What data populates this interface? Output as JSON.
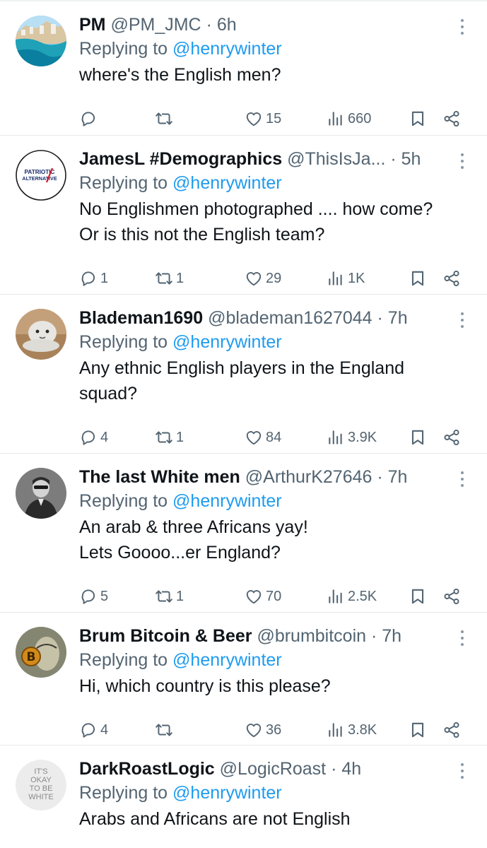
{
  "tweets": [
    {
      "name": "PM",
      "handle": "@PM_JMC",
      "time": "6h",
      "replying_prefix": "Replying to",
      "replying_to": "@henrywinter",
      "text_lines": [
        "where's the English men?"
      ],
      "replies": "",
      "retweets": "",
      "likes": "15",
      "views": "660",
      "avatar": "coastline-photo"
    },
    {
      "name": "JamesL #Demographics",
      "handle": "@ThisIsJa...",
      "time": "5h",
      "replying_prefix": "Replying to",
      "replying_to": "@henrywinter",
      "text_lines": [
        "No Englishmen photographed .... how come?",
        "Or is this not the English team?"
      ],
      "replies": "1",
      "retweets": "1",
      "likes": "29",
      "views": "1K",
      "avatar": "patriotic-alternative-logo",
      "avatar_text": [
        "PATRIOTIC",
        "ALTERNATIVE"
      ]
    },
    {
      "name": "Blademan1690",
      "handle": "@blademan1627044",
      "time": "7h",
      "replying_prefix": "Replying to",
      "replying_to": "@henrywinter",
      "text_lines": [
        "Any ethnic English players in the England",
        "squad?"
      ],
      "replies": "4",
      "retweets": "1",
      "likes": "84",
      "views": "3.9K",
      "avatar": "plush-toy-photo"
    },
    {
      "name": "The last White men",
      "handle": "@ArthurK27646",
      "time": "7h",
      "replying_prefix": "Replying to",
      "replying_to": "@henrywinter",
      "text_lines": [
        "An arab & three Africans yay!",
        "Lets Goooo...er England?"
      ],
      "replies": "5",
      "retweets": "1",
      "likes": "70",
      "views": "2.5K",
      "avatar": "man-portrait-bw"
    },
    {
      "name": "Brum Bitcoin & Beer",
      "handle": "@brumbitcoin",
      "time": "7h",
      "replying_prefix": "Replying to",
      "replying_to": "@henrywinter",
      "text_lines": [
        "Hi, which country is this please?"
      ],
      "replies": "4",
      "retweets": "",
      "likes": "36",
      "views": "3.8K",
      "avatar": "bitcoin-banknote"
    },
    {
      "name": "DarkRoastLogic",
      "handle": "@LogicRoast",
      "time": "4h",
      "replying_prefix": "Replying to",
      "replying_to": "@henrywinter",
      "text_lines": [
        "Arabs and Africans are not English"
      ],
      "replies": "",
      "retweets": "",
      "likes": "",
      "views": "",
      "avatar": "text-logo",
      "avatar_text": [
        "IT'S",
        "OKAY",
        "TO BE",
        "WHITE"
      ]
    }
  ],
  "dot_separator": "·",
  "colors": {
    "text": "#0f1419",
    "secondary": "#536471",
    "link": "#1d9bf0",
    "divider": "#e7e9ea"
  }
}
